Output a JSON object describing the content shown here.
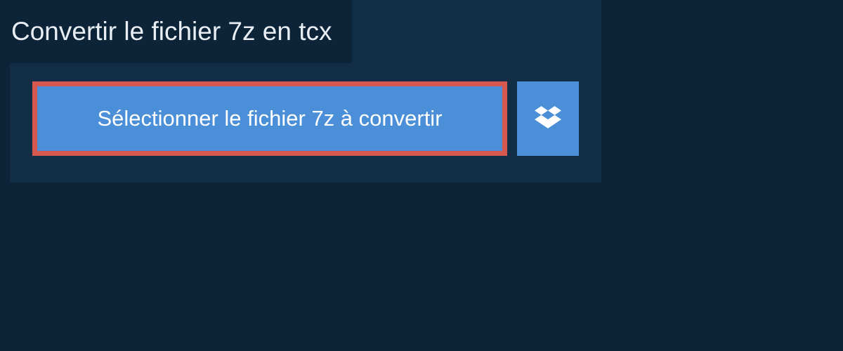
{
  "header": {
    "title": "Convertir le fichier 7z en tcx"
  },
  "buttons": {
    "select_file_label": "Sélectionner le fichier 7z à convertir"
  },
  "colors": {
    "background": "#0d2438",
    "card": "#122e47",
    "button_primary": "#4a8fd8",
    "highlight_border": "#d55850",
    "text_light": "#ffffff"
  }
}
